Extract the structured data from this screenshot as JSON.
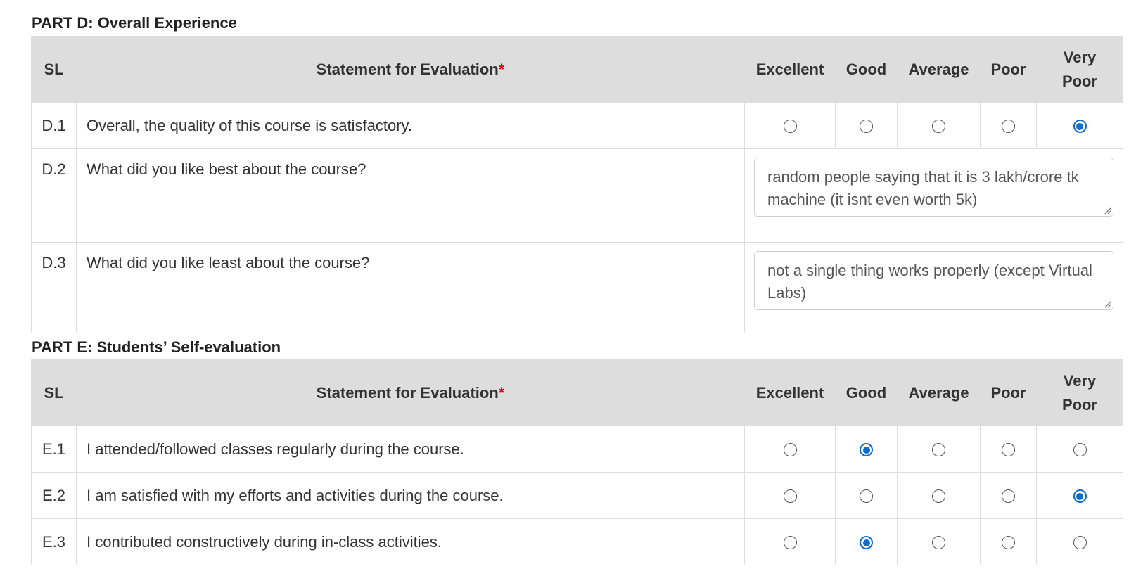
{
  "sections": [
    {
      "title": "PART D: Overall Experience",
      "headers": {
        "sl": "SL",
        "statement": "Statement for Evaluation",
        "required_mark": "*",
        "excellent": "Excellent",
        "good": "Good",
        "average": "Average",
        "poor": "Poor",
        "very_poor_line1": "Very",
        "very_poor_line2": "Poor"
      },
      "rows": [
        {
          "sl": "D.1",
          "statement": "Overall, the quality of this course is satisfactory.",
          "type": "rating",
          "selected": "Very Poor"
        },
        {
          "sl": "D.2",
          "statement": "What did you like best about the course?",
          "type": "text",
          "answer": "random people saying that it is 3 lakh/crore tk machine (it isnt even worth 5k)"
        },
        {
          "sl": "D.3",
          "statement": "What did you like least about the course?",
          "type": "text",
          "answer": "not a single thing works properly (except Virtual Labs)"
        }
      ]
    },
    {
      "title": "PART E: Students’ Self-evaluation",
      "headers": {
        "sl": "SL",
        "statement": "Statement for Evaluation",
        "required_mark": "*",
        "excellent": "Excellent",
        "good": "Good",
        "average": "Average",
        "poor": "Poor",
        "very_poor_line1": "Very",
        "very_poor_line2": "Poor"
      },
      "rows": [
        {
          "sl": "E.1",
          "statement": "I attended/followed classes regularly during the course.",
          "type": "rating",
          "selected": "Good"
        },
        {
          "sl": "E.2",
          "statement": "I am satisfied with my efforts and activities during the course.",
          "type": "rating",
          "selected": "Very Poor"
        },
        {
          "sl": "E.3",
          "statement": "I contributed constructively during in-class activities.",
          "type": "rating",
          "selected": "Good"
        }
      ]
    }
  ],
  "colors": {
    "header_bg": "#dddddd",
    "radio_selected": "#0b6cd6",
    "required": "#e00000"
  }
}
